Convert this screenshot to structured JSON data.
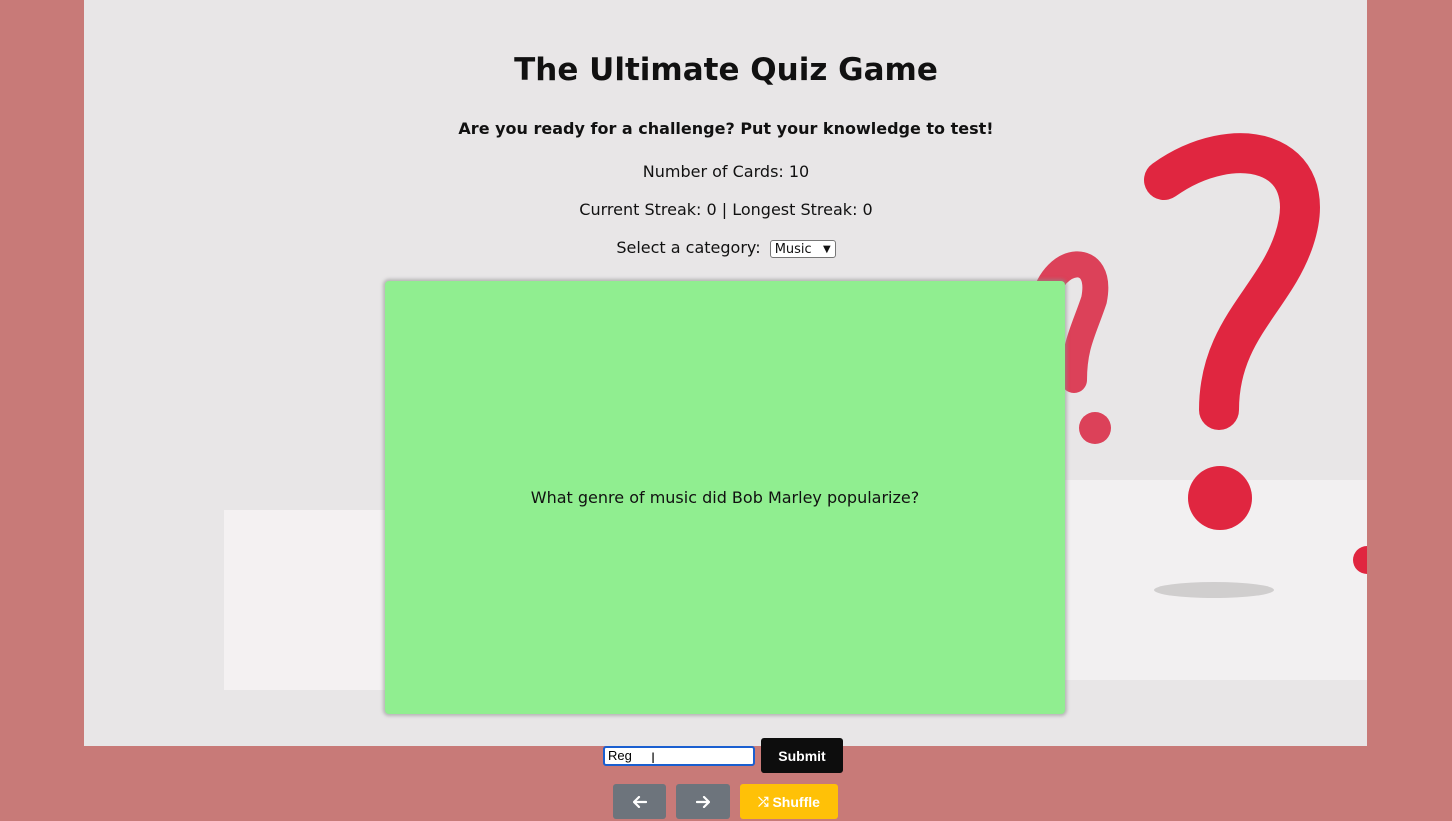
{
  "header": {
    "title": "The Ultimate Quiz Game",
    "subtitle": "Are you ready for a challenge? Put your knowledge to test!"
  },
  "stats": {
    "cards_label": "Number of Cards: 10",
    "streak_label": "Current Streak: 0 | Longest Streak: 0"
  },
  "category": {
    "label": "Select a category:",
    "selected": "Music"
  },
  "card": {
    "question": "What genre of music did Bob Marley popularize?",
    "color": "#90ee90"
  },
  "answer": {
    "value": "Reg"
  },
  "buttons": {
    "submit": "Submit",
    "prev_icon": "arrow-left-icon",
    "next_icon": "arrow-right-icon",
    "shuffle": "Shuffle",
    "shuffle_icon": "shuffle-icon"
  },
  "colors": {
    "page_background": "#c87a78",
    "panel_background": "#e8e6e7",
    "submit": "#0d0d0d",
    "nav": "#6d747c",
    "shuffle": "#ffc107"
  }
}
